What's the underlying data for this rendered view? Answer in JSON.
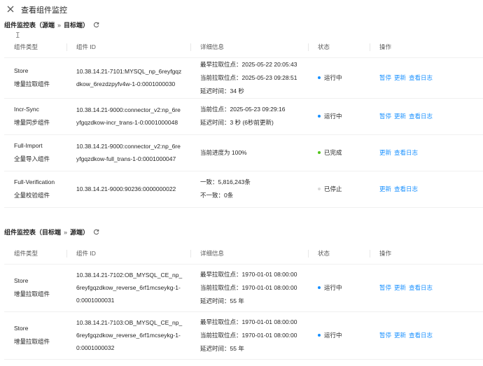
{
  "header": {
    "title": "查看组件监控",
    "close_icon": "close-icon"
  },
  "cursor_glyph": "I",
  "colors": {
    "running": "#1890ff",
    "done": "#52c41a",
    "stopped": "#d9d9d9",
    "link": "#1890ff"
  },
  "columns": [
    "组件类型",
    "组件 ID",
    "详细信息",
    "状态",
    "操作"
  ],
  "sections": [
    {
      "title_prefix": "组件监控表（源端",
      "arrow": "»",
      "title_suffix": "目标端）",
      "rows": [
        {
          "type": "Store",
          "type_cn": "增量拉取组件",
          "id": "10.38.14.21-7101:MYSQL_np_6reyfgqzdkow_6rezdzpyfv4w-1-0:0001000030",
          "details": [
            "最早拉取位点：2025-05-22 20:05:43",
            "当前拉取位点：2025-05-23 09:28:51",
            "延迟时间：34 秒"
          ],
          "status": "运行中",
          "status_kind": "running",
          "actions": [
            "暂停",
            "更新",
            "查看日志"
          ]
        },
        {
          "type": "Incr-Sync",
          "type_cn": "增量同步组件",
          "id": "10.38.14.21-9000:connector_v2:np_6reyfgqzdkow-incr_trans-1-0:0001000048",
          "details": [
            "当前位点：2025-05-23 09:29:16",
            "延迟时间：3 秒 (6秒前更新)"
          ],
          "status": "运行中",
          "status_kind": "running",
          "actions": [
            "暂停",
            "更新",
            "查看日志"
          ]
        },
        {
          "type": "Full-Import",
          "type_cn": "全量导入组件",
          "id": "10.38.14.21-9000:connector_v2:np_6reyfgqzdkow-full_trans-1-0:0001000047",
          "details": [
            "当前进度为 100%"
          ],
          "status": "已完成",
          "status_kind": "done",
          "actions": [
            "更新",
            "查看日志"
          ]
        },
        {
          "type": "Full-Verification",
          "type_cn": "全量校验组件",
          "id": "10.38.14.21-9000:90236:0000000022",
          "details": [
            "一致：5,816,243条",
            "不一致：0条"
          ],
          "status": "已停止",
          "status_kind": "stopped",
          "actions": [
            "更新",
            "查看日志"
          ]
        }
      ]
    },
    {
      "title_prefix": "组件监控表（目标端",
      "arrow": "»",
      "title_suffix": "源端）",
      "rows": [
        {
          "type": "Store",
          "type_cn": "增量拉取组件",
          "id": "10.38.14.21-7102:OB_MYSQL_CE_np_6reyfgqzdkow_reverse_6rf1mcseykg-1-0:0001000031",
          "details": [
            "最早拉取位点：1970-01-01 08:00:00",
            "当前拉取位点：1970-01-01 08:00:00",
            "延迟时间：55 年"
          ],
          "status": "运行中",
          "status_kind": "running",
          "actions": [
            "暂停",
            "更新",
            "查看日志"
          ]
        },
        {
          "type": "Store",
          "type_cn": "增量拉取组件",
          "id": "10.38.14.21-7103:OB_MYSQL_CE_np_6reyfgqzdkow_reverse_6rf1mcseykg-1-0:0001000032",
          "details": [
            "最早拉取位点：1970-01-01 08:00:00",
            "当前拉取位点：1970-01-01 08:00:00",
            "延迟时间：55 年"
          ],
          "status": "运行中",
          "status_kind": "running",
          "actions": [
            "暂停",
            "更新",
            "查看日志"
          ]
        }
      ]
    }
  ]
}
